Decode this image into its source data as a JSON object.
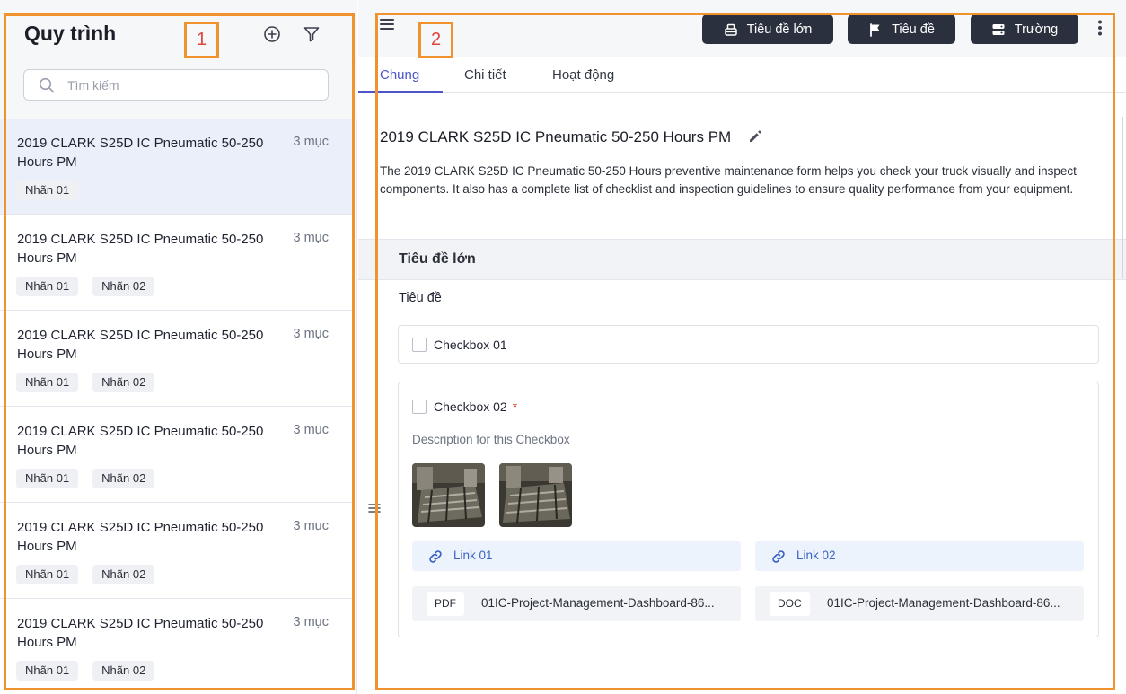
{
  "sidebar": {
    "title": "Quy trình",
    "add_icon": "plus-circle-icon",
    "filter_icon": "filter-icon",
    "search_placeholder": "Tìm kiếm",
    "items": [
      {
        "title": "2019 CLARK S25D IC Pneumatic 50-250 Hours PM",
        "count": "3 mục",
        "tags": [
          "Nhãn 01"
        ],
        "active": true
      },
      {
        "title": "2019 CLARK S25D IC Pneumatic 50-250 Hours PM",
        "count": "3 mục",
        "tags": [
          "Nhãn 01",
          "Nhãn 02"
        ]
      },
      {
        "title": "2019 CLARK S25D IC Pneumatic 50-250 Hours PM",
        "count": "3 mục",
        "tags": [
          "Nhãn 01",
          "Nhãn 02"
        ]
      },
      {
        "title": "2019 CLARK S25D IC Pneumatic 50-250 Hours PM",
        "count": "3 mục",
        "tags": [
          "Nhãn 01",
          "Nhãn 02"
        ]
      },
      {
        "title": "2019 CLARK S25D IC Pneumatic 50-250 Hours PM",
        "count": "3 mục",
        "tags": [
          "Nhãn 01",
          "Nhãn 02"
        ]
      },
      {
        "title": "2019 CLARK S25D IC Pneumatic 50-250 Hours PM",
        "count": "3 mục",
        "tags": [
          "Nhãn 01",
          "Nhãn 02"
        ]
      }
    ]
  },
  "toolbar": {
    "menu_icon": "hamburger-icon",
    "buttons": [
      {
        "label": "Tiêu đề lớn",
        "icon": "header-icon"
      },
      {
        "label": "Tiêu đề",
        "icon": "flag-icon"
      },
      {
        "label": "Trường",
        "icon": "field-icon"
      }
    ],
    "more_icon": "kebab-icon"
  },
  "tabs": [
    {
      "label": "Chung",
      "active": true
    },
    {
      "label": "Chi tiết"
    },
    {
      "label": "Hoạt động"
    }
  ],
  "document": {
    "title": "2019 CLARK S25D IC Pneumatic 50-250 Hours PM",
    "description": "The 2019 CLARK S25D IC Pneumatic 50-250 Hours preventive maintenance form helps you check your truck visually and inspect components. It also has a complete list of checklist and inspection guidelines to ensure quality performance from your equipment.",
    "section_title": "Tiêu đề lớn",
    "subsection_title": "Tiêu đề",
    "checkbox1": {
      "label": "Checkbox 01"
    },
    "checkbox2": {
      "label": "Checkbox 02",
      "required_mark": "*",
      "description": "Description for this Checkbox",
      "links": [
        "Link 01",
        "Link 02"
      ],
      "files": [
        {
          "type": "PDF",
          "name": "01IC-Project-Management-Dashboard-86..."
        },
        {
          "type": "DOC",
          "name": "01IC-Project-Management-Dashboard-86..."
        }
      ]
    }
  },
  "annotations": [
    "1",
    "2"
  ],
  "colors": {
    "accent": "#4a56c9",
    "button_dark": "#2a303d",
    "annotation": "#f0922e",
    "link": "#3b63c4",
    "required": "#e0453a"
  }
}
